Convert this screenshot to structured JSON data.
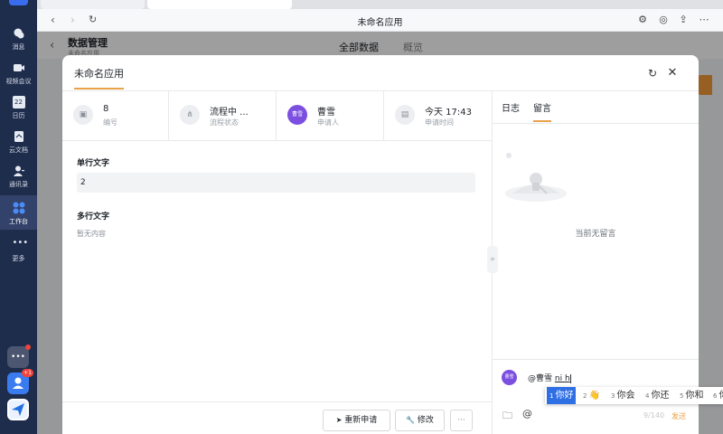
{
  "sidebar": {
    "items": [
      {
        "label": "消息",
        "icon": "chat-icon"
      },
      {
        "label": "视频会议",
        "icon": "video-icon"
      },
      {
        "label": "日历",
        "icon": "calendar-icon",
        "day": "22"
      },
      {
        "label": "云文档",
        "icon": "docs-icon"
      },
      {
        "label": "通讯录",
        "icon": "contacts-icon"
      },
      {
        "label": "工作台",
        "icon": "workbench-icon"
      },
      {
        "label": "更多",
        "icon": "more-icon"
      }
    ],
    "badge": "+1"
  },
  "browser": {
    "title": "未命名应用"
  },
  "background_page": {
    "back": "‹",
    "title": "数据管理",
    "subtitle": "未命名应用",
    "tabs": [
      "全部数据",
      "概览"
    ]
  },
  "modal": {
    "title": "未命名应用",
    "info": [
      {
        "value": "8",
        "label": "编号",
        "icon": "id-icon"
      },
      {
        "value": "流程中 ...",
        "label": "流程状态",
        "icon": "flow-icon"
      },
      {
        "value": "曹雪",
        "label": "申请人",
        "avatar": "曹雪"
      },
      {
        "value": "今天 17:43",
        "label": "申请时间",
        "icon": "clock-icon"
      }
    ],
    "fields": [
      {
        "label": "单行文字",
        "value": "2"
      },
      {
        "label": "多行文字",
        "value": "暂无内容"
      }
    ],
    "footer": {
      "resubmit": "重新申请",
      "edit": "修改",
      "more": "···"
    }
  },
  "right_panel": {
    "tabs": [
      "日志",
      "留言"
    ],
    "active_tab": "留言",
    "empty_message": "当前无留言",
    "compose": {
      "avatar": "曹雪",
      "text_prefix": "@曹雪 ",
      "text_typing": "ni h",
      "count": "9/140",
      "send": "发送"
    }
  },
  "ime": {
    "candidates": [
      {
        "n": "1",
        "text": "你好"
      },
      {
        "n": "2",
        "text": "👋"
      },
      {
        "n": "3",
        "text": "你会"
      },
      {
        "n": "4",
        "text": "你还"
      },
      {
        "n": "5",
        "text": "你和"
      },
      {
        "n": "6",
        "text": "你"
      }
    ]
  },
  "colors": {
    "accent": "#e8a24a",
    "avatar": "#7b4fe0",
    "ime_select": "#2f6fe4",
    "rail": "#1f2d4d"
  }
}
